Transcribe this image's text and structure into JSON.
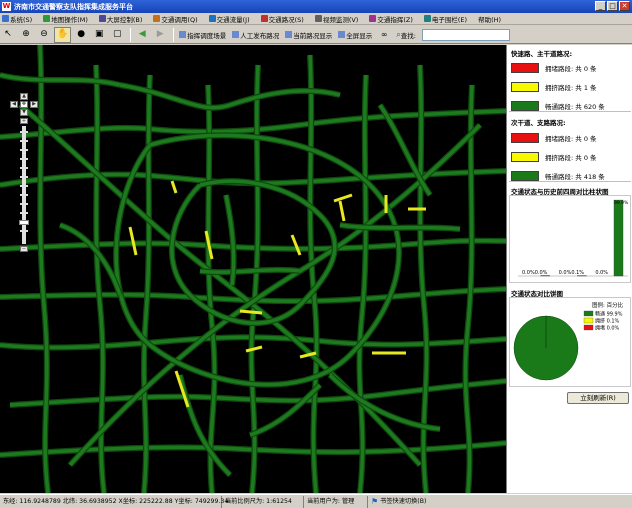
{
  "window": {
    "title": "济南市交通警察支队指挥集成服务平台",
    "app_icon_glyph": "W",
    "min_glyph": "_",
    "max_glyph": "□",
    "close_glyph": "✕"
  },
  "menu": [
    {
      "label": "系统(S)",
      "icon": "system-icon",
      "color": "#3a6fd0"
    },
    {
      "label": "地图操作(M)",
      "icon": "map-icon",
      "color": "#2a9a3a"
    },
    {
      "label": "大屏控制(B)",
      "icon": "screen-icon",
      "color": "#4a4a9a"
    },
    {
      "label": "交通调用(Q)",
      "icon": "query-icon",
      "color": "#c07020"
    },
    {
      "label": "交通流量(J)",
      "icon": "flow-icon",
      "color": "#2070c0"
    },
    {
      "label": "交通路况(S)",
      "icon": "traffic-icon",
      "color": "#c03030"
    },
    {
      "label": "视频监测(V)",
      "icon": "video-icon",
      "color": "#606060"
    },
    {
      "label": "交通指挥(Z)",
      "icon": "command-icon",
      "color": "#a03090"
    },
    {
      "label": "电子围栏(E)",
      "icon": "fence-icon",
      "color": "#208080"
    },
    {
      "label": "帮助(H)",
      "icon": "",
      "color": ""
    }
  ],
  "toolbar": {
    "tools": [
      {
        "name": "pointer-tool",
        "glyph": "↖"
      },
      {
        "name": "zoom-in-tool",
        "glyph": "⊕"
      },
      {
        "name": "zoom-out-tool",
        "glyph": "⊖"
      },
      {
        "name": "pan-tool",
        "glyph": "✋",
        "active": true
      },
      {
        "name": "globe-tool",
        "glyph": "●"
      },
      {
        "name": "full-extent-tool",
        "glyph": "▣"
      },
      {
        "name": "refresh-tool",
        "glyph": "▢"
      }
    ],
    "back_glyph": "◀",
    "forward_glyph": "▶",
    "text_buttons": [
      {
        "label": "指挥调度场景",
        "icon": "dispatch-icon"
      },
      {
        "label": "人工发布路况",
        "icon": "publish-icon"
      },
      {
        "label": "当前路况显示",
        "icon": "current-icon"
      },
      {
        "label": "全屏显示",
        "icon": "fullscreen-icon"
      }
    ],
    "search_label": "查找:",
    "search_value": ""
  },
  "map": {
    "background": "#000000",
    "road_color": "#1e7a1e",
    "road_edge": "#0f4a0f",
    "congested_color": "#e8e820"
  },
  "panel": {
    "main_roads_title": "快速路、主干道路况:",
    "main_roads": [
      {
        "color": "#e81010",
        "text": "拥堵路段: 共 0 条"
      },
      {
        "color": "#f8f800",
        "text": "拥挤路段: 共 1 条"
      },
      {
        "color": "#1a7a1a",
        "text": "畅通路段: 共 620 条"
      }
    ],
    "minor_roads_title": "次干道、支路路况:",
    "minor_roads": [
      {
        "color": "#e81010",
        "text": "拥堵路段: 共 0 条"
      },
      {
        "color": "#f8f800",
        "text": "拥挤路段: 共 0 条"
      },
      {
        "color": "#1a7a1a",
        "text": "畅通路段: 共 418 条"
      }
    ],
    "compare_title": "交通状态与历史前四周对比柱状图",
    "pie_title": "交通状态对比饼图",
    "refresh_button": "立刻刷新(R)"
  },
  "chart_data": [
    {
      "type": "bar",
      "title": "交通状态与历史前四周对比柱状图",
      "categories": [
        "拥堵",
        "拥挤",
        "畅通"
      ],
      "series": [
        {
          "values": [
            0.0,
            0.1,
            99.9
          ]
        }
      ],
      "data_labels": [
        "0.0%0.0%",
        "0.0%0.1%",
        "0.0%"
      ],
      "top_label": "99.9%",
      "ylim": [
        0,
        100
      ],
      "colors": [
        "#e81010",
        "#f8f800",
        "#1a7a1a"
      ]
    },
    {
      "type": "pie",
      "title": "交通状态对比饼图",
      "legend_title": "图例: 百分比",
      "slices": [
        {
          "label": "畅通",
          "value": 99.9,
          "color": "#1a7a1a",
          "text": "畅通 99.9%"
        },
        {
          "label": "拥挤",
          "value": 0.1,
          "color": "#f8f800",
          "text": "拥挤 0.1%"
        },
        {
          "label": "拥堵",
          "value": 0.0,
          "color": "#e81010",
          "text": "拥堵 0.0%"
        }
      ]
    }
  ],
  "status": {
    "coords": "东经: 116.9248789  北纬: 36.6938952  X坐标: 225222.88  Y坐标: 749299.34",
    "scale": "当前比例尺为: 1:61254",
    "user": "当前用户为: 管理",
    "switch_label": "书签快速切换(B)"
  }
}
